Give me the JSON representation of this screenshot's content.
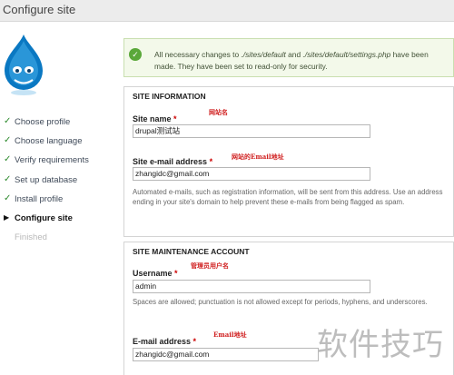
{
  "header": {
    "title": "Configure site"
  },
  "steps": [
    {
      "label": "Choose profile",
      "state": "done",
      "icon": "check-icon"
    },
    {
      "label": "Choose language",
      "state": "done",
      "icon": "check-icon"
    },
    {
      "label": "Verify requirements",
      "state": "done",
      "icon": "check-icon"
    },
    {
      "label": "Set up database",
      "state": "done",
      "icon": "check-icon"
    },
    {
      "label": "Install profile",
      "state": "done",
      "icon": "check-icon"
    },
    {
      "label": "Configure site",
      "state": "active",
      "icon": "active-step-icon"
    },
    {
      "label": "Finished",
      "state": "pending",
      "icon": ""
    }
  ],
  "status_message": {
    "icon": "ok-icon",
    "text_before": "All necessary changes to ",
    "path1": "./sites/default",
    "text_mid": " and ",
    "path2": "./sites/default/settings.php",
    "text_after": " have been made. They have been set to read-only for security."
  },
  "site_information": {
    "legend": "SITE INFORMATION",
    "site_name": {
      "label": "Site name",
      "required": "*",
      "annotation": "网站名",
      "value": "drupal测试站"
    },
    "site_email": {
      "label": "Site e-mail address",
      "required": "*",
      "annotation": "网站的Email地址",
      "value": "zhangidc@gmail.com",
      "help": "Automated e-mails, such as registration information, will be sent from this address. Use an address ending in your site's domain to help prevent these e-mails from being flagged as spam."
    }
  },
  "maintenance_account": {
    "legend": "SITE MAINTENANCE ACCOUNT",
    "username": {
      "label": "Username",
      "required": "*",
      "annotation": "管理员用户名",
      "value": "admin",
      "help": "Spaces are allowed; punctuation is not allowed except for periods, hyphens, and underscores."
    },
    "email": {
      "label": "E-mail address",
      "required": "*",
      "annotation": "Email地址",
      "value": "zhangidc@gmail.com"
    }
  },
  "watermark": "软件技巧",
  "colors": {
    "success": "#5aa83a",
    "required": "#cc0000",
    "annotation": "#d02020",
    "header_bg": "#ececec"
  }
}
